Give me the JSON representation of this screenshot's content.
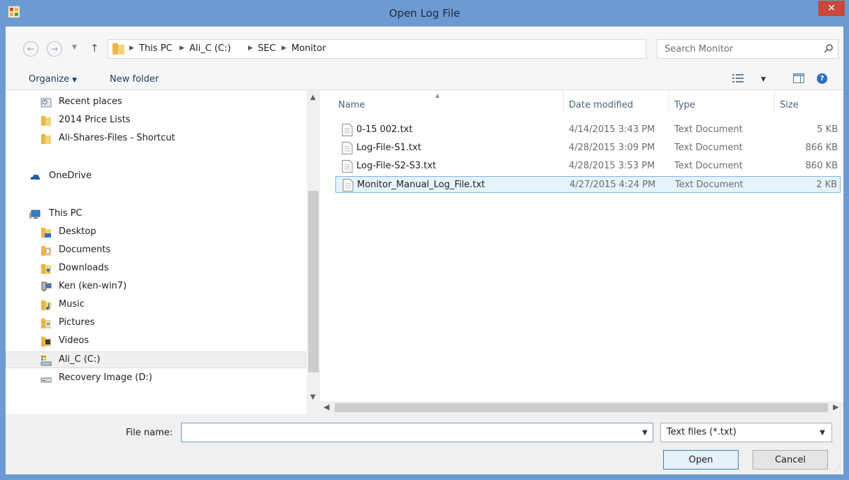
{
  "window": {
    "title": "Open Log File",
    "close_symbol": "✕"
  },
  "address": {
    "back_symbol": "←",
    "forward_symbol": "→",
    "up_symbol": "↑",
    "crumbs": [
      "This PC",
      "Ali_C (C:)",
      "SEC",
      "Monitor"
    ],
    "search_placeholder": "Search Monitor"
  },
  "toolbar": {
    "organize_label": "Organize",
    "new_folder_label": "New folder",
    "help_symbol": "?"
  },
  "nav": {
    "items": [
      {
        "label": "Recent places",
        "icon": "recent-places-icon"
      },
      {
        "label": "2014 Price Lists",
        "icon": "folder-icon"
      },
      {
        "label": "Ali-Shares-Files - Shortcut",
        "icon": "folder-icon"
      },
      {
        "label": "OneDrive",
        "icon": "onedrive-icon"
      },
      {
        "label": "This PC",
        "icon": "computer-icon"
      },
      {
        "label": "Desktop",
        "icon": "desktop-folder-icon"
      },
      {
        "label": "Documents",
        "icon": "documents-folder-icon"
      },
      {
        "label": "Downloads",
        "icon": "downloads-folder-icon"
      },
      {
        "label": "Ken (ken-win7)",
        "icon": "network-computer-icon"
      },
      {
        "label": "Music",
        "icon": "music-folder-icon"
      },
      {
        "label": "Pictures",
        "icon": "pictures-folder-icon"
      },
      {
        "label": "Videos",
        "icon": "videos-folder-icon"
      },
      {
        "label": "Ali_C (C:)",
        "icon": "drive-icon",
        "selected": true
      },
      {
        "label": "Recovery Image (D:)",
        "icon": "drive-icon"
      }
    ]
  },
  "files": {
    "columns": [
      "Name",
      "Date modified",
      "Type",
      "Size"
    ],
    "rows": [
      {
        "name": "0-15 002.txt",
        "date": "4/14/2015 3:43 PM",
        "type": "Text Document",
        "size": "5 KB"
      },
      {
        "name": "Log-File-S1.txt",
        "date": "4/28/2015 3:09 PM",
        "type": "Text Document",
        "size": "866 KB"
      },
      {
        "name": "Log-File-S2-S3.txt",
        "date": "4/28/2015 3:53 PM",
        "type": "Text Document",
        "size": "860 KB"
      },
      {
        "name": "Monitor_Manual_Log_File.txt",
        "date": "4/27/2015 4:24 PM",
        "type": "Text Document",
        "size": "2 KB",
        "selected": true
      }
    ]
  },
  "bottom": {
    "file_name_label": "File name:",
    "file_name_value": "",
    "file_type": "Text files (*.txt)",
    "open_label": "Open",
    "cancel_label": "Cancel"
  },
  "colors": {
    "title_bar": "#6c9bd2",
    "close_button": "#c7493b",
    "selection_fill": "#e5f3fb",
    "selection_border": "#7eb4ea",
    "folder_yellow": "#e8b64a"
  }
}
